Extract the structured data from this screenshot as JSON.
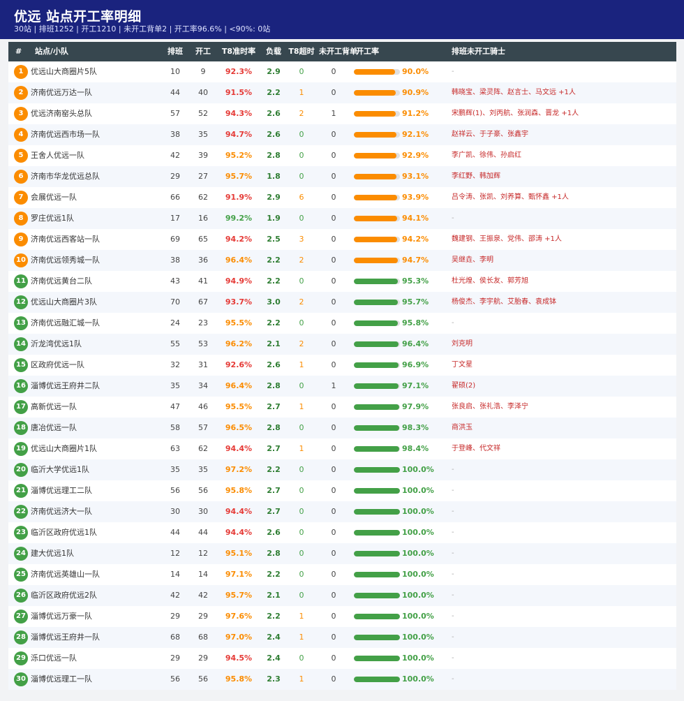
{
  "header": {
    "title": "优远  站点开工率明细",
    "subtitle": "30站 | 排班1252 | 开工1210 | 未开工背单2 | 开工率96.6% | <90%: 0站"
  },
  "columns": {
    "index": "#",
    "name": "站点/小队",
    "scheduled": "排班",
    "started": "开工",
    "t8_rate": "T8准时率",
    "load": "负载",
    "t8_overtime": "T8超时",
    "unstarted_orders": "未开工背单",
    "start_rate": "开工率",
    "unstarted_riders": "排班未开工骑士"
  },
  "colors": {
    "header_bg": "#1a237e",
    "table_head_bg": "#37474f",
    "orange": "#fb8c00",
    "green": "#43a047",
    "red": "#e53935",
    "rider_red": "#c62828"
  },
  "rows": [
    {
      "rank": "1",
      "name": "优远山大商圈片5队",
      "scheduled": "10",
      "started": "9",
      "t8": "92.3%",
      "load": "2.9",
      "overtime": "0",
      "unacked": "0",
      "rate": "90.0%",
      "rate_value": 90.0,
      "riders": "-"
    },
    {
      "rank": "2",
      "name": "济南优远万达一队",
      "scheduled": "44",
      "started": "40",
      "t8": "91.5%",
      "load": "2.2",
      "overtime": "1",
      "unacked": "0",
      "rate": "90.9%",
      "rate_value": 90.9,
      "riders": "韩晓宝、梁灵阵、赵言士、马文远 +1人"
    },
    {
      "rank": "3",
      "name": "优远济南窑头总队",
      "scheduled": "57",
      "started": "52",
      "t8": "94.3%",
      "load": "2.6",
      "overtime": "2",
      "unacked": "1",
      "rate": "91.2%",
      "rate_value": 91.2,
      "riders": "宋鹏辉(1)、刘丙航、张润森、晋龙 +1人"
    },
    {
      "rank": "4",
      "name": "济南优远西市场一队",
      "scheduled": "38",
      "started": "35",
      "t8": "94.7%",
      "load": "2.6",
      "overtime": "0",
      "unacked": "0",
      "rate": "92.1%",
      "rate_value": 92.1,
      "riders": "赵祥云、于子豪、张鑫宇"
    },
    {
      "rank": "5",
      "name": "王舍人优远一队",
      "scheduled": "42",
      "started": "39",
      "t8": "95.2%",
      "load": "2.8",
      "overtime": "0",
      "unacked": "0",
      "rate": "92.9%",
      "rate_value": 92.9,
      "riders": "李广凯、徐伟、孙启红"
    },
    {
      "rank": "6",
      "name": "济南市华龙优远总队",
      "scheduled": "29",
      "started": "27",
      "t8": "95.7%",
      "load": "1.8",
      "overtime": "0",
      "unacked": "0",
      "rate": "93.1%",
      "rate_value": 93.1,
      "riders": "李红野、韩加辉"
    },
    {
      "rank": "7",
      "name": "会展优远一队",
      "scheduled": "66",
      "started": "62",
      "t8": "91.9%",
      "load": "2.9",
      "overtime": "6",
      "unacked": "0",
      "rate": "93.9%",
      "rate_value": 93.9,
      "riders": "吕令涛、张凯、刘养算、甄怀鑫 +1人"
    },
    {
      "rank": "8",
      "name": "罗庄优远1队",
      "scheduled": "17",
      "started": "16",
      "t8": "99.2%",
      "load": "1.9",
      "overtime": "0",
      "unacked": "0",
      "rate": "94.1%",
      "rate_value": 94.1,
      "riders": "-"
    },
    {
      "rank": "9",
      "name": "济南优远西客站一队",
      "scheduled": "69",
      "started": "65",
      "t8": "94.2%",
      "load": "2.5",
      "overtime": "3",
      "unacked": "0",
      "rate": "94.2%",
      "rate_value": 94.2,
      "riders": "魏建钢、王振泉、党伟、邵涛 +1人"
    },
    {
      "rank": "10",
      "name": "济南优远领秀城一队",
      "scheduled": "38",
      "started": "36",
      "t8": "96.4%",
      "load": "2.2",
      "overtime": "2",
      "unacked": "0",
      "rate": "94.7%",
      "rate_value": 94.7,
      "riders": "吴继垚、李明"
    },
    {
      "rank": "11",
      "name": "济南优远黄台二队",
      "scheduled": "43",
      "started": "41",
      "t8": "94.9%",
      "load": "2.2",
      "overtime": "0",
      "unacked": "0",
      "rate": "95.3%",
      "rate_value": 95.3,
      "riders": "杜光煌、侯长友、郭芳旭"
    },
    {
      "rank": "12",
      "name": "优远山大商圈片3队",
      "scheduled": "70",
      "started": "67",
      "t8": "93.7%",
      "load": "3.0",
      "overtime": "2",
      "unacked": "0",
      "rate": "95.7%",
      "rate_value": 95.7,
      "riders": "杨俊杰、李宇航、艾胎春、袁成钵"
    },
    {
      "rank": "13",
      "name": "济南优远融汇城一队",
      "scheduled": "24",
      "started": "23",
      "t8": "95.5%",
      "load": "2.2",
      "overtime": "0",
      "unacked": "0",
      "rate": "95.8%",
      "rate_value": 95.8,
      "riders": "-"
    },
    {
      "rank": "14",
      "name": "沂龙湾优远1队",
      "scheduled": "55",
      "started": "53",
      "t8": "96.2%",
      "load": "2.1",
      "overtime": "2",
      "unacked": "0",
      "rate": "96.4%",
      "rate_value": 96.4,
      "riders": "刘克明"
    },
    {
      "rank": "15",
      "name": "区政府优远一队",
      "scheduled": "32",
      "started": "31",
      "t8": "92.6%",
      "load": "2.6",
      "overtime": "1",
      "unacked": "0",
      "rate": "96.9%",
      "rate_value": 96.9,
      "riders": "丁文星"
    },
    {
      "rank": "16",
      "name": "淄博优远王府井二队",
      "scheduled": "35",
      "started": "34",
      "t8": "96.4%",
      "load": "2.8",
      "overtime": "0",
      "unacked": "1",
      "rate": "97.1%",
      "rate_value": 97.1,
      "riders": "翟硕(2)"
    },
    {
      "rank": "17",
      "name": "高新优远一队",
      "scheduled": "47",
      "started": "46",
      "t8": "95.5%",
      "load": "2.7",
      "overtime": "1",
      "unacked": "0",
      "rate": "97.9%",
      "rate_value": 97.9,
      "riders": "张良启、张礼浩、李泽宁"
    },
    {
      "rank": "18",
      "name": "唐冶优远一队",
      "scheduled": "58",
      "started": "57",
      "t8": "96.5%",
      "load": "2.8",
      "overtime": "0",
      "unacked": "0",
      "rate": "98.3%",
      "rate_value": 98.3,
      "riders": "商洪玉"
    },
    {
      "rank": "19",
      "name": "优远山大商圈片1队",
      "scheduled": "63",
      "started": "62",
      "t8": "94.4%",
      "load": "2.7",
      "overtime": "1",
      "unacked": "0",
      "rate": "98.4%",
      "rate_value": 98.4,
      "riders": "于登峰、代文祥"
    },
    {
      "rank": "20",
      "name": "临沂大学优远1队",
      "scheduled": "35",
      "started": "35",
      "t8": "97.2%",
      "load": "2.2",
      "overtime": "0",
      "unacked": "0",
      "rate": "100.0%",
      "rate_value": 100.0,
      "riders": "-"
    },
    {
      "rank": "21",
      "name": "淄博优远理工二队",
      "scheduled": "56",
      "started": "56",
      "t8": "95.8%",
      "load": "2.7",
      "overtime": "0",
      "unacked": "0",
      "rate": "100.0%",
      "rate_value": 100.0,
      "riders": "-"
    },
    {
      "rank": "22",
      "name": "济南优远济大一队",
      "scheduled": "30",
      "started": "30",
      "t8": "94.4%",
      "load": "2.7",
      "overtime": "0",
      "unacked": "0",
      "rate": "100.0%",
      "rate_value": 100.0,
      "riders": "-"
    },
    {
      "rank": "23",
      "name": "临沂区政府优远1队",
      "scheduled": "44",
      "started": "44",
      "t8": "94.4%",
      "load": "2.6",
      "overtime": "0",
      "unacked": "0",
      "rate": "100.0%",
      "rate_value": 100.0,
      "riders": "-"
    },
    {
      "rank": "24",
      "name": "建大优远1队",
      "scheduled": "12",
      "started": "12",
      "t8": "95.1%",
      "load": "2.8",
      "overtime": "0",
      "unacked": "0",
      "rate": "100.0%",
      "rate_value": 100.0,
      "riders": "-"
    },
    {
      "rank": "25",
      "name": "济南优远英雄山一队",
      "scheduled": "14",
      "started": "14",
      "t8": "97.1%",
      "load": "2.2",
      "overtime": "0",
      "unacked": "0",
      "rate": "100.0%",
      "rate_value": 100.0,
      "riders": "-"
    },
    {
      "rank": "26",
      "name": "临沂区政府优远2队",
      "scheduled": "42",
      "started": "42",
      "t8": "95.7%",
      "load": "2.1",
      "overtime": "0",
      "unacked": "0",
      "rate": "100.0%",
      "rate_value": 100.0,
      "riders": "-"
    },
    {
      "rank": "27",
      "name": "淄博优远万豪一队",
      "scheduled": "29",
      "started": "29",
      "t8": "97.6%",
      "load": "2.2",
      "overtime": "1",
      "unacked": "0",
      "rate": "100.0%",
      "rate_value": 100.0,
      "riders": "-"
    },
    {
      "rank": "28",
      "name": "淄博优远王府井一队",
      "scheduled": "68",
      "started": "68",
      "t8": "97.0%",
      "load": "2.4",
      "overtime": "1",
      "unacked": "0",
      "rate": "100.0%",
      "rate_value": 100.0,
      "riders": "-"
    },
    {
      "rank": "29",
      "name": "泺口优远一队",
      "scheduled": "29",
      "started": "29",
      "t8": "94.5%",
      "load": "2.4",
      "overtime": "0",
      "unacked": "0",
      "rate": "100.0%",
      "rate_value": 100.0,
      "riders": "-"
    },
    {
      "rank": "30",
      "name": "淄博优远理工一队",
      "scheduled": "56",
      "started": "56",
      "t8": "95.8%",
      "load": "2.3",
      "overtime": "1",
      "unacked": "0",
      "rate": "100.0%",
      "rate_value": 100.0,
      "riders": "-"
    }
  ]
}
